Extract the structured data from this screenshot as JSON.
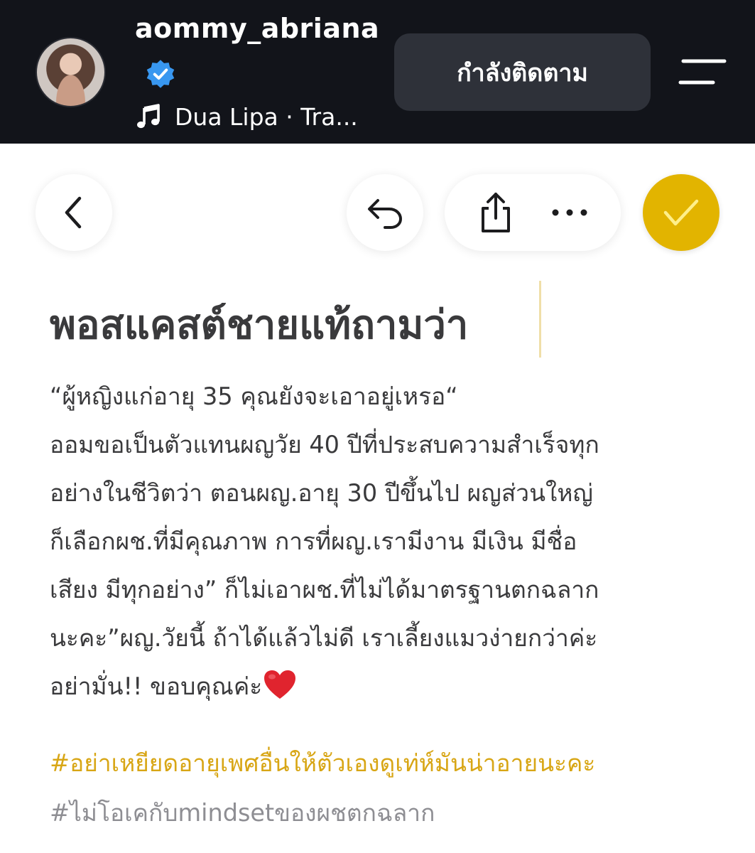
{
  "profile": {
    "username": "aommy_abriana",
    "verified": true,
    "music": "Dua Lipa · Tra...",
    "follow_button": "กำลังติดตาม"
  },
  "icons": {
    "avatar": "profile-photo",
    "verified": "verified-badge-icon",
    "music": "music-note-icon",
    "menu": "menu-icon",
    "back": "chevron-left-icon",
    "undo": "undo-icon",
    "share": "share-icon",
    "more": "more-horizontal-icon",
    "done": "checkmark-icon"
  },
  "colors": {
    "header_bg": "#12141a",
    "accent": "#e2b400",
    "hashtag_yellow": "#d8a615",
    "hashtag_gray": "#8e8e93",
    "verified_blue": "#3897f0"
  },
  "note": {
    "title": "พอสแคสต์ชายแท้ถามว่า",
    "lines": [
      "“ผู้หญิงแก่อายุ 35 คุณยังจะเอาอยู่เหรอ“",
      "ออมขอเป็นตัวแทนผญวัย 40 ปีที่ประสบความสำเร็จทุก",
      "อย่างในชีวิตว่า ตอนผญ.อายุ 30 ปีขึ้นไป ผญส่วนใหญ่",
      "ก็เลือกผช.ที่มีคุณภาพ การที่ผญ.เรามีงาน มีเงิน มีชื่อ",
      "เสียง มีทุกอย่าง” ก็ไม่เอาผช.ที่ไม่ได้มาตรฐานตกฉลาก",
      "นะคะ”ผญ.วัยนี้ ถ้าได้แล้วไม่ดี เราเลี้ยงแมวง่ายกว่าค่ะ",
      "อย่ามั่น!! ขอบคุณค่ะ"
    ],
    "heart_emoji": "❤️",
    "hashtag_1": "#อย่าเหยียดอายุเพศอื่นให้ตัวเองดูเท่ห์มันน่าอายนะคะ",
    "hashtag_2": "#ไม่โอเคกับmindsetของผชตกฉลาก"
  }
}
